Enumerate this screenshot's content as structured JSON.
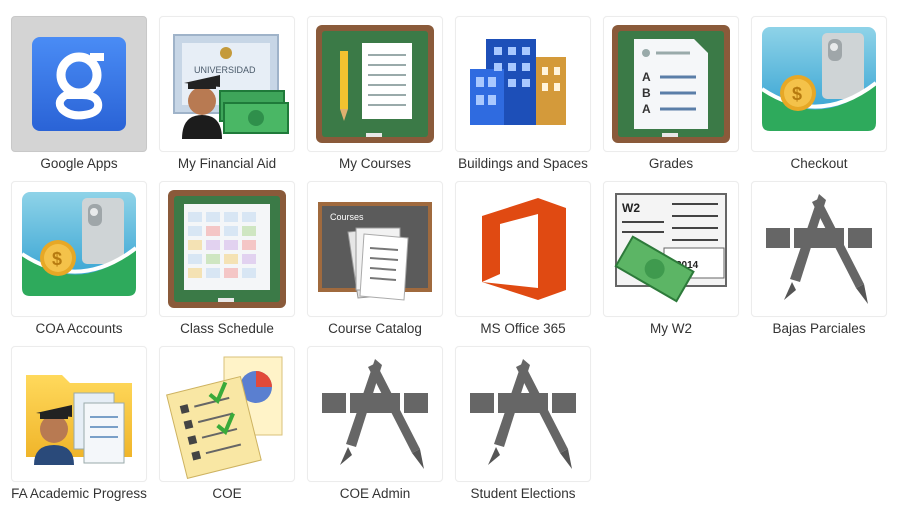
{
  "apps": [
    {
      "label": "Google Apps",
      "icon": "google-apps-icon",
      "selected": true
    },
    {
      "label": "My Financial Aid",
      "icon": "financial-aid-icon"
    },
    {
      "label": "My Courses",
      "icon": "notebook-chalkboard-icon"
    },
    {
      "label": "Buildings and Spaces",
      "icon": "buildings-icon"
    },
    {
      "label": "Grades",
      "icon": "grades-chalkboard-icon"
    },
    {
      "label": "Checkout",
      "icon": "wallet-coin-icon"
    },
    {
      "label": "COA Accounts",
      "icon": "wallet-coin-icon"
    },
    {
      "label": "Class Schedule",
      "icon": "schedule-chalkboard-icon"
    },
    {
      "label": "Course Catalog",
      "icon": "course-catalog-icon"
    },
    {
      "label": "MS Office 365",
      "icon": "office-365-icon"
    },
    {
      "label": "My W2",
      "icon": "w2-form-icon"
    },
    {
      "label": "Bajas Parciales",
      "icon": "app-store-icon"
    },
    {
      "label": "FA Academic Progress",
      "icon": "folder-graduate-icon"
    },
    {
      "label": "COE",
      "icon": "checklist-chart-icon"
    },
    {
      "label": "COE Admin",
      "icon": "app-store-icon"
    },
    {
      "label": "Student Elections",
      "icon": "app-store-icon"
    }
  ],
  "icon_text": {
    "universidad": "UNIVERSIDAD",
    "abc": [
      "A",
      "B",
      "A"
    ],
    "courses": "Courses",
    "w2": "W2",
    "year": "2014"
  },
  "colors": {
    "google_blue": "#2f6fe3",
    "chalkboard_green": "#3b7a47",
    "chalkboard_frame": "#8a5a3a",
    "office_red": "#e04a12",
    "app_store_gray": "#666666",
    "wallet_green": "#2eaa5c"
  }
}
